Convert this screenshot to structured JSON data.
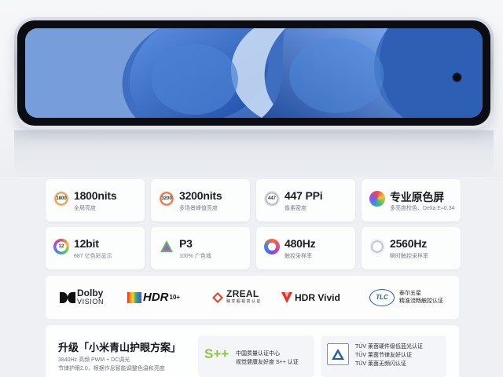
{
  "specs": [
    {
      "icon": "brightness-1800-icon",
      "icon_text": "1800",
      "value": "1800nits",
      "sub": "全局亮度"
    },
    {
      "icon": "brightness-3200-icon",
      "icon_text": "3200",
      "value": "3200nits",
      "sub": "多场景峰值亮度"
    },
    {
      "icon": "ppi-icon",
      "icon_text": "447",
      "value": "447 PPi",
      "sub": "像素密度"
    },
    {
      "icon": "color-calibration-icon",
      "icon_text": "",
      "value": "专业原色屏",
      "sub": "多亮度校色、Delta E≈0.34"
    },
    {
      "icon": "bit-depth-icon",
      "icon_text": "12",
      "value": "12bit",
      "sub": "687 亿色彩显示"
    },
    {
      "icon": "p3-gamut-icon",
      "icon_text": "",
      "value": "P3",
      "sub": "100% 广色域"
    },
    {
      "icon": "touch-sampling-icon",
      "icon_text": "",
      "value": "480Hz",
      "sub": "触控采样率"
    },
    {
      "icon": "instant-touch-icon",
      "icon_text": "",
      "value": "2560Hz",
      "sub": "瞬时触控采样率"
    }
  ],
  "logos": {
    "dolby_line1": "Dolby",
    "dolby_line2": "VISION",
    "hdr10": "HDR",
    "hdr10_suffix": "10+",
    "zreal": "ZREAL",
    "zreal_sub": "臻 享 超 视 真 认 证",
    "hdrvivid": "HDR Vivid",
    "tlc": "TLC",
    "tlc_line1": "泰尔五星",
    "tlc_line2": "精准流畅触控认证"
  },
  "eyecare": {
    "title": "升级「小米青山护眼方案」",
    "line1": "3840Hz 高频 PWM + DC调光",
    "line2": "节律护眼2.0，根据作息智能调整色温和亮度",
    "cert1_mark": "S++",
    "cert1_line1": "中国质量认证中心",
    "cert1_line2": "视觉健康友好度 S++ 认证",
    "cert2_line1": "TÜV 莱茵硬件级低蓝光认证",
    "cert2_line2": "TÜV 莱茵节律友好认证",
    "cert2_line3": "TÜV 莱茵无频闪认证"
  },
  "colors": {
    "screen_blue": "#3f74c7",
    "sky_light": "#a9c7ee",
    "hdr_gradient": [
      "#e02b2b",
      "#f28a1b",
      "#f5d33a",
      "#3bb54a",
      "#2a7de1",
      "#7b3fc9"
    ],
    "hdrvivid_red": "#e4322b",
    "tlc_blue": "#1f5fae",
    "s_plus_green": "#8cc63f"
  }
}
